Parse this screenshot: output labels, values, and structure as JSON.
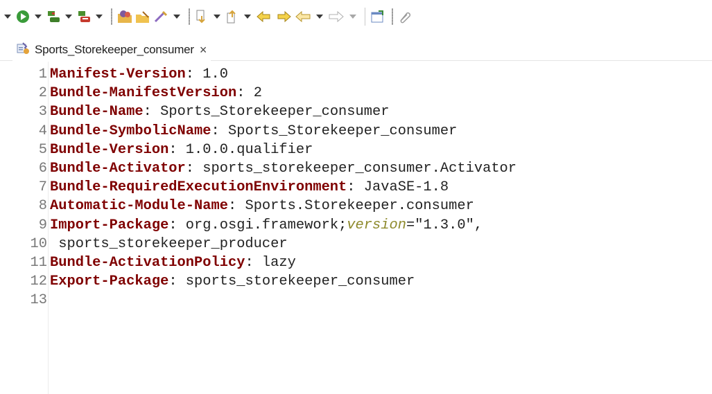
{
  "toolbar": {
    "icons": [
      "run-icon",
      "debug-icon",
      "coverage-icon",
      "new-java-project-icon",
      "open-type-icon",
      "search-icon",
      "next-annotation-icon",
      "previous-annotation-icon",
      "last-edit-location-icon",
      "back-icon",
      "forward-icon",
      "pin-editor-icon",
      "link-icon"
    ]
  },
  "tab": {
    "label": "Sports_Storekeeper_consumer",
    "close": "×"
  },
  "editor": {
    "lines": [
      {
        "n": "1",
        "key": "Manifest-Version",
        "sep": ":",
        "value": " 1.0"
      },
      {
        "n": "2",
        "key": "Bundle-ManifestVersion",
        "sep": ":",
        "value": " 2"
      },
      {
        "n": "3",
        "key": "Bundle-Name",
        "sep": ":",
        "value": " Sports_Storekeeper_consumer"
      },
      {
        "n": "4",
        "key": "Bundle-SymbolicName",
        "sep": ":",
        "value": " Sports_Storekeeper_consumer"
      },
      {
        "n": "5",
        "key": "Bundle-Version",
        "sep": ":",
        "value": " 1.0.0.qualifier"
      },
      {
        "n": "6",
        "key": "Bundle-Activator",
        "sep": ":",
        "value": " sports_storekeeper_consumer.Activator"
      },
      {
        "n": "7",
        "key": "Bundle-RequiredExecutionEnvironment",
        "sep": ":",
        "value": " JavaSE-1.8"
      },
      {
        "n": "8",
        "key": "Automatic-Module-Name",
        "sep": ":",
        "value": " Sports.Storekeeper.consumer"
      },
      {
        "n": "9",
        "key": "Import-Package",
        "sep": ":",
        "value": " org.osgi.framework;",
        "attr": "version",
        "attr_eq": "=",
        "attr_val": "\"1.3.0\","
      },
      {
        "n": "10",
        "key": "",
        "sep": "",
        "value": " sports_storekeeper_producer"
      },
      {
        "n": "11",
        "key": "Bundle-ActivationPolicy",
        "sep": ":",
        "value": " lazy"
      },
      {
        "n": "12",
        "key": "Export-Package",
        "sep": ":",
        "value": " sports_storekeeper_consumer"
      },
      {
        "n": "13",
        "key": "",
        "sep": "",
        "value": ""
      }
    ]
  },
  "colors": {
    "keyword": "#7f0000",
    "attribute": "#8e8a2c",
    "line_number": "#787878"
  }
}
